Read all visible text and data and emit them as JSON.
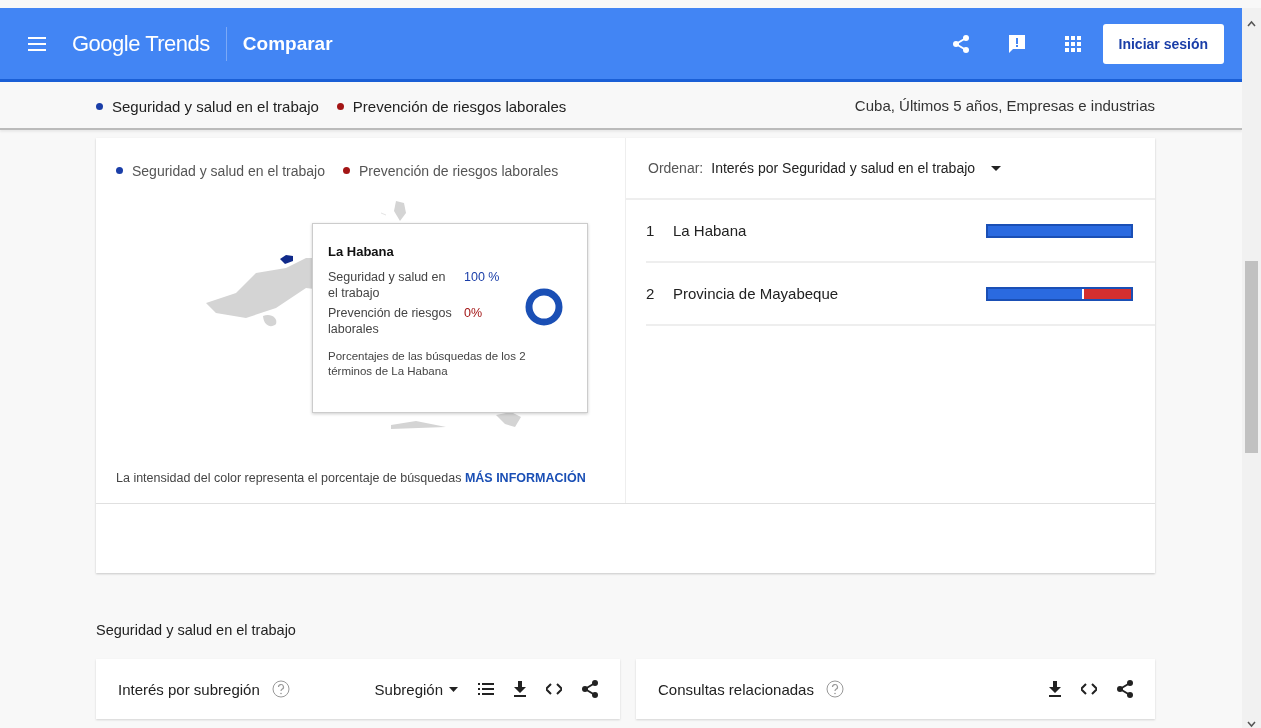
{
  "header": {
    "logo": "Google Trends",
    "title": "Comparar",
    "sign_in": "Iniciar sesión"
  },
  "terms": [
    {
      "label": "Seguridad y salud en el trabajo",
      "color": "#1a3ea8"
    },
    {
      "label": "Prevención de riesgos laborales",
      "color": "#a31515"
    }
  ],
  "filters": "Cuba, Últimos 5 años, Empresas e industrias",
  "geo": {
    "legend": [
      {
        "label": "Seguridad y salud en el trabajo",
        "color": "#1a3ea8"
      },
      {
        "label": "Prevención de riesgos laborales",
        "color": "#a31515"
      }
    ],
    "tooltip": {
      "region": "La Habana",
      "terms": [
        {
          "label": "Seguridad y salud en el trabajo",
          "value": "100 %"
        },
        {
          "label": "Prevención de riesgos laborales",
          "value": "0%"
        }
      ],
      "note": "Porcentajes de las búsquedas de los 2 términos de La Habana"
    },
    "footnote": "La intensidad del color representa el porcentaje de búsquedas",
    "more_link": "MÁS INFORMACIÓN",
    "sort_label": "Ordenar:",
    "sort_value": "Interés por Seguridad y salud en el trabajo",
    "rows": [
      {
        "rank": "1",
        "name": "La Habana",
        "level": 1
      },
      {
        "rank": "2",
        "name": "Provincia de Mayabeque",
        "level": 0.66
      }
    ]
  },
  "section_title": "Seguridad y salud en el trabajo",
  "cards": [
    {
      "title": "Interés por subregión",
      "dropdown": "Subregión"
    },
    {
      "title": "Consultas relacionadas"
    }
  ]
}
